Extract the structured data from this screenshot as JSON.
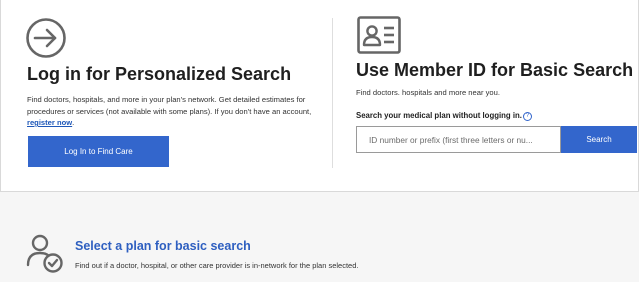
{
  "login": {
    "icon": "login-arrow-icon",
    "title": "Log in for Personalized Search",
    "description": "Find doctors, hospitals, and more in your plan's network. Get detailed estimates for procedures or services (not available with some plans). If you don't have an account, ",
    "register_link": "register now",
    "register_suffix": ".",
    "button_label": "Log In to Find Care"
  },
  "member_id": {
    "icon": "id-card-icon",
    "title": "Use Member ID for Basic Search",
    "description": "Find doctors. hospitals and more near you.",
    "search_label": "Search your medical plan without logging in.",
    "help_icon": "?",
    "input_placeholder": "ID number or prefix (first three letters or nu...",
    "input_value": "",
    "search_button": "Search"
  },
  "select_plan": {
    "icon": "person-check-icon",
    "title": "Select a plan for basic search",
    "description": "Find out if a doctor, hospital, or other care provider is in-network for the plan selected."
  },
  "colors": {
    "accent": "#3366cc",
    "link": "#2e5fc0",
    "icon_gray": "#666666",
    "background": "#f6f6f6"
  }
}
